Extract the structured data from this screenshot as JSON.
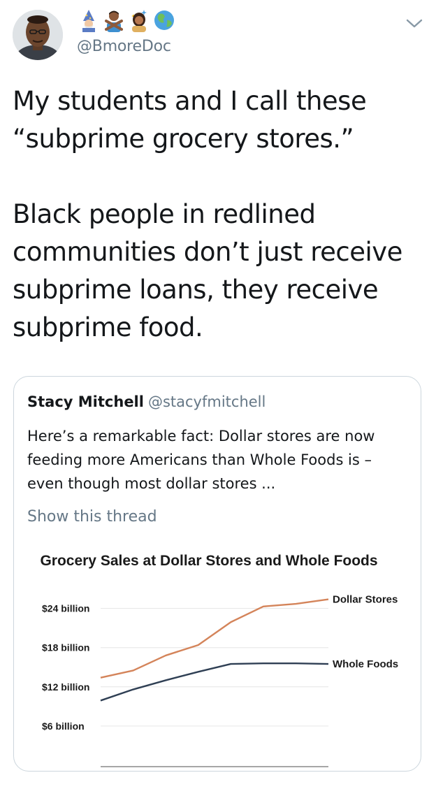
{
  "tweet": {
    "handle": "@BmoreDoc",
    "name_emojis": [
      "wizard-emoji",
      "man-gesturing-no-emoji",
      "woman-raising-hand-emoji",
      "globe-emoji"
    ],
    "text": "My students and I call these\n“subprime grocery stores.”\n\nBlack people in redlined\ncommunities don’t just receive\nsubprime loans, they receive\nsubprime food."
  },
  "quoted_tweet": {
    "name": "Stacy Mitchell",
    "handle": "@stacyfmitchell",
    "text": "Here’s a remarkable fact: Dollar stores are now feeding more Americans than Whole Foods is – even though most dollar stores ...",
    "show_thread_label": "Show this thread"
  },
  "chart_data": {
    "type": "line",
    "title": "Grocery Sales at Dollar Stores and Whole Foods",
    "y_tick_labels": [
      "$24 billion",
      "$18 billion",
      "$12 billion",
      "$6 billion"
    ],
    "y_ticks": [
      24,
      18,
      12,
      6
    ],
    "ylim": [
      0,
      24
    ],
    "grid": true,
    "x": [
      0,
      1,
      2,
      3,
      4,
      5,
      6,
      7
    ],
    "series": [
      {
        "name": "Dollar Stores",
        "color": "#d4845a",
        "values": [
          13.4,
          14.5,
          16.8,
          18.4,
          21.9,
          24.3,
          24.7,
          25.4
        ]
      },
      {
        "name": "Whole Foods",
        "color": "#2f3f54",
        "values": [
          9.9,
          11.6,
          13.0,
          14.3,
          15.5,
          15.6,
          15.6,
          15.5
        ]
      }
    ]
  }
}
